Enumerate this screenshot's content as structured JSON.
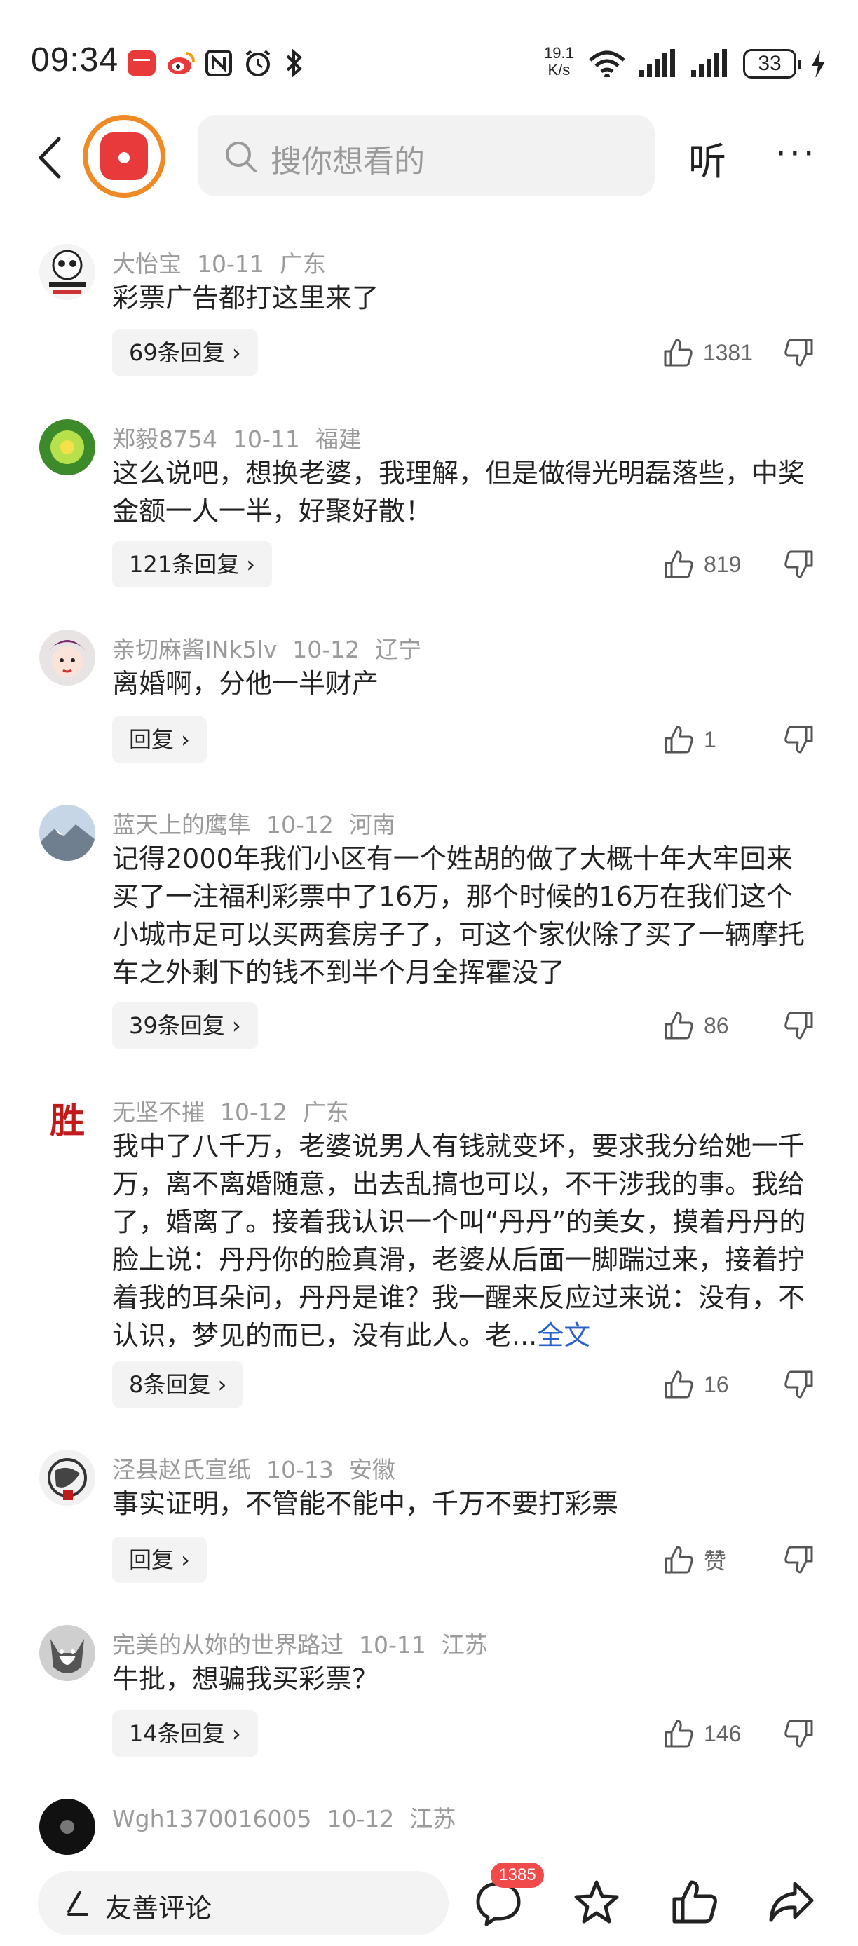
{
  "status_bar": {
    "time": "09:34",
    "net_speed": "19.1",
    "net_speed_unit": "K/s",
    "battery": "33"
  },
  "top_nav": {
    "search_placeholder": "搜你想看的",
    "listen_label": "听",
    "more_label": "···"
  },
  "comments": [
    {
      "user": "大怡宝",
      "date": "10-11",
      "location": "广东",
      "text": "彩票广告都打这里来了",
      "reply": "69条回复 ›",
      "likes": "1381"
    },
    {
      "user": "郑毅8754",
      "date": "10-11",
      "location": "福建",
      "text": "这么说吧，想换老婆，我理解，但是做得光明磊落些，中奖金额一人一半，好聚好散！",
      "reply": "121条回复 ›",
      "likes": "819"
    },
    {
      "user": "亲切麻酱INk5lv",
      "date": "10-12",
      "location": "辽宁",
      "text": "离婚啊，分他一半财产",
      "reply": "回复 ›",
      "likes": "1"
    },
    {
      "user": "蓝天上的鹰隼",
      "date": "10-12",
      "location": "河南",
      "text": "记得2000年我们小区有一个姓胡的做了大概十年大牢回来买了一注福利彩票中了16万，那个时候的16万在我们这个小城市足可以买两套房子了，可这个家伙除了买了一辆摩托车之外剩下的钱不到半个月全挥霍没了",
      "reply": "39条回复 ›",
      "likes": "86"
    },
    {
      "user": "无坚不摧",
      "date": "10-12",
      "location": "广东",
      "text": "我中了八千万，老婆说男人有钱就变坏，要求我分给她一千万，离不离婚随意，出去乱搞也可以，不干涉我的事。我给了，婚离了。接着我认识一个叫“丹丹”的美女，摸着丹丹的脸上说：丹丹你的脸真滑，老婆从后面一脚踹过来，接着拧着我的耳朵问，丹丹是谁？我一醒来反应过来说：没有，不认识，梦见的而已，没有此人。老...",
      "full_text_link": "全文",
      "reply": "8条回复 ›",
      "likes": "16"
    },
    {
      "user": "泾县赵氏宣纸",
      "date": "10-13",
      "location": "安徽",
      "text": "事实证明，不管能不能中，千万不要打彩票",
      "reply": "回复 ›",
      "likes": "赞"
    },
    {
      "user": "完美的从妳的世界路过",
      "date": "10-11",
      "location": "江苏",
      "text": "牛批，想骗我买彩票？",
      "reply": "14条回复 ›",
      "likes": "146"
    },
    {
      "user": "Wgh1370016005",
      "date": "10-12",
      "location": "江苏"
    }
  ],
  "bottom_bar": {
    "input_placeholder": "友善评论",
    "comment_count": "1385"
  }
}
